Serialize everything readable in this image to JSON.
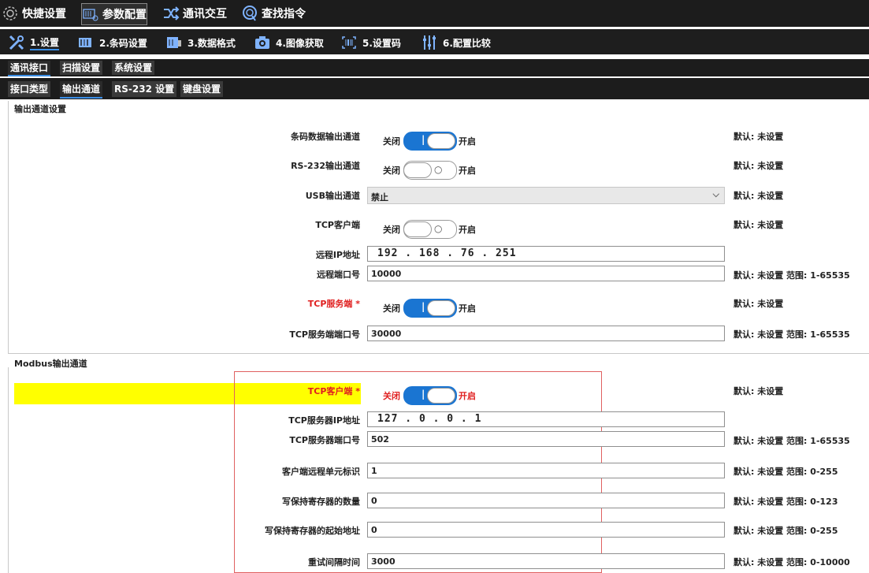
{
  "menubar": {
    "items": [
      {
        "label": "快捷设置",
        "icon": "gear-icon"
      },
      {
        "label": "参数配置",
        "icon": "barcode-settings-icon",
        "active": true
      },
      {
        "label": "通讯交互",
        "icon": "shuffle-icon"
      },
      {
        "label": "查找指令",
        "icon": "search-icon"
      }
    ]
  },
  "toolbar": {
    "items": [
      {
        "label": "1.设置",
        "icon": "tools-icon",
        "active": true
      },
      {
        "label": "2.条码设置",
        "icon": "barcode-icon"
      },
      {
        "label": "3.数据格式",
        "icon": "data-format-icon"
      },
      {
        "label": "4.图像获取",
        "icon": "camera-icon"
      },
      {
        "label": "5.设置码",
        "icon": "scan-code-icon"
      },
      {
        "label": "6.配置比较",
        "icon": "sliders-icon"
      }
    ]
  },
  "subtabs1": [
    "通讯接口",
    "扫描设置",
    "系统设置"
  ],
  "subtabs2": [
    "接口类型",
    "输出通道",
    "RS-232 设置",
    "键盘设置"
  ],
  "section1": {
    "title": "输出通道设置",
    "barcode_output": {
      "label": "条码数据输出通道",
      "off": "关闭",
      "on": "开启",
      "state": "on",
      "default": "默认: 未设置"
    },
    "rs232_output": {
      "label": "RS-232输出通道",
      "off": "关闭",
      "on": "开启",
      "state": "off",
      "default": "默认: 未设置"
    },
    "usb_output": {
      "label": "USB输出通道",
      "value": "禁止",
      "default": "默认: 未设置"
    },
    "tcp_client": {
      "label": "TCP客户端",
      "off": "关闭",
      "on": "开启",
      "state": "off",
      "default": "默认: 未设置"
    },
    "remote_ip": {
      "label": "远程IP地址",
      "value": "192 . 168 . 76 . 251"
    },
    "remote_port": {
      "label": "远程端口号",
      "value": "10000",
      "default": "默认: 未设置  范围: 1-65535"
    },
    "tcp_server": {
      "label": "TCP服务端 *",
      "off": "关闭",
      "on": "开启",
      "state": "on",
      "default": "默认: 未设置"
    },
    "tcp_server_port": {
      "label": "TCP服务端端口号",
      "value": "30000",
      "default": "默认: 未设置  范围: 1-65535"
    }
  },
  "section2": {
    "title": "Modbus输出通道",
    "tcp_client": {
      "label": "TCP客户端 *",
      "off": "关闭",
      "on": "开启",
      "state": "on",
      "default": "默认: 未设置"
    },
    "server_ip": {
      "label": "TCP服务器IP地址",
      "value": "127 .  0  .  0  .  1"
    },
    "server_port": {
      "label": "TCP服务器端口号",
      "value": "502",
      "default": "默认: 未设置  范围: 1-65535"
    },
    "unit_id": {
      "label": "客户端远程单元标识",
      "value": "1",
      "default": "默认: 未设置  范围: 0-255"
    },
    "reg_count": {
      "label": "写保持寄存器的数量",
      "value": "0",
      "default": "默认: 未设置  范围: 0-123"
    },
    "reg_start": {
      "label": "写保持寄存器的起始地址",
      "value": "0",
      "default": "默认: 未设置  范围: 0-255"
    },
    "retry": {
      "label": "重试间隔时间",
      "value": "3000",
      "default": "默认: 未设置  范围: 0-10000"
    }
  },
  "colors": {
    "accent": "#1a75d2",
    "required": "#e02020",
    "highlight": "#ffff00",
    "bar_bg": "#1c1c1c"
  }
}
